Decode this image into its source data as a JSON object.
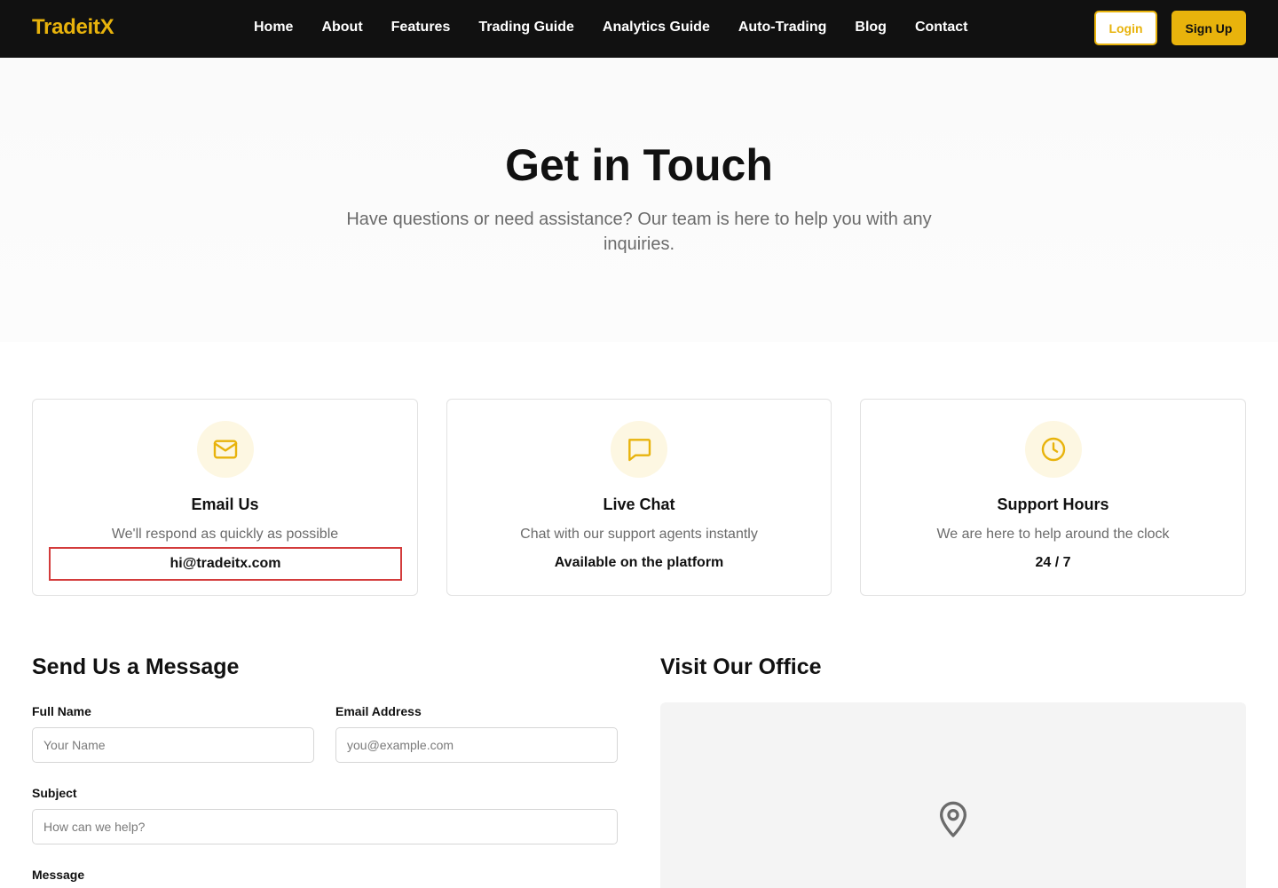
{
  "brand": "TradeitX",
  "nav": {
    "links": [
      "Home",
      "About",
      "Features",
      "Trading Guide",
      "Analytics Guide",
      "Auto-Trading",
      "Blog",
      "Contact"
    ],
    "login_label": "Login",
    "signup_label": "Sign Up"
  },
  "hero": {
    "title": "Get in Touch",
    "subtitle": "Have questions or need assistance? Our team is here to help you with any inquiries."
  },
  "cards": [
    {
      "icon": "mail-icon",
      "title": "Email Us",
      "description": "We'll respond as quickly as possible",
      "value": "hi@tradeitx.com"
    },
    {
      "icon": "chat-icon",
      "title": "Live Chat",
      "description": "Chat with our support agents instantly",
      "value": "Available on the platform"
    },
    {
      "icon": "clock-icon",
      "title": "Support Hours",
      "description": "We are here to help around the clock",
      "value": "24 / 7"
    }
  ],
  "form": {
    "title": "Send Us a Message",
    "full_name_label": "Full Name",
    "full_name_placeholder": "Your Name",
    "email_label": "Email Address",
    "email_placeholder": "you@example.com",
    "subject_label": "Subject",
    "subject_placeholder": "How can we help?",
    "message_label": "Message"
  },
  "office": {
    "title": "Visit Our Office"
  },
  "colors": {
    "accent": "#e8b30c",
    "nav_bg": "#111111",
    "highlight_border": "#d33b3b"
  }
}
